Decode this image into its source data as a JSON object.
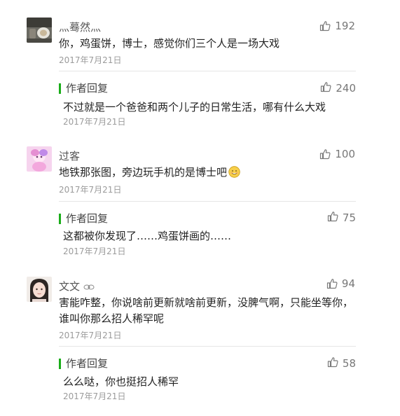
{
  "comments": [
    {
      "nickname": "灬蓦然灬",
      "text": "你，鸡蛋饼，博士，感觉你们三个人是一场大戏",
      "date": "2017年7月21日",
      "likes": "192",
      "reply": {
        "title": "作者回复",
        "text": "不过就是一个爸爸和两个儿子的日常生活，哪有什么大戏",
        "date": "2017年7月21日",
        "likes": "240"
      }
    },
    {
      "nickname": "过客",
      "text": "地铁那张图，旁边玩手机的是博士吧",
      "date": "2017年7月21日",
      "likes": "100",
      "emoji": "grinning-emoji-icon",
      "reply": {
        "title": "作者回复",
        "text": "这都被你发现了……鸡蛋饼画的……",
        "date": "2017年7月21日",
        "likes": "75"
      }
    },
    {
      "nickname": "文文",
      "text": "害能咋整，你说啥前更新就啥前更新，没脾气啊，只能坐等你，谁叫你那么招人稀罕呢",
      "date": "2017年7月21日",
      "likes": "94",
      "reply": {
        "title": "作者回复",
        "text": "么么哒，你也挺招人稀罕",
        "date": "2017年7月21日",
        "likes": "58"
      }
    }
  ],
  "colors": {
    "accent_green": "#1aad19",
    "muted_text": "#9b9b9b",
    "divider": "#e6e6e6"
  },
  "icons": {
    "like": "thumbs-up-icon"
  }
}
